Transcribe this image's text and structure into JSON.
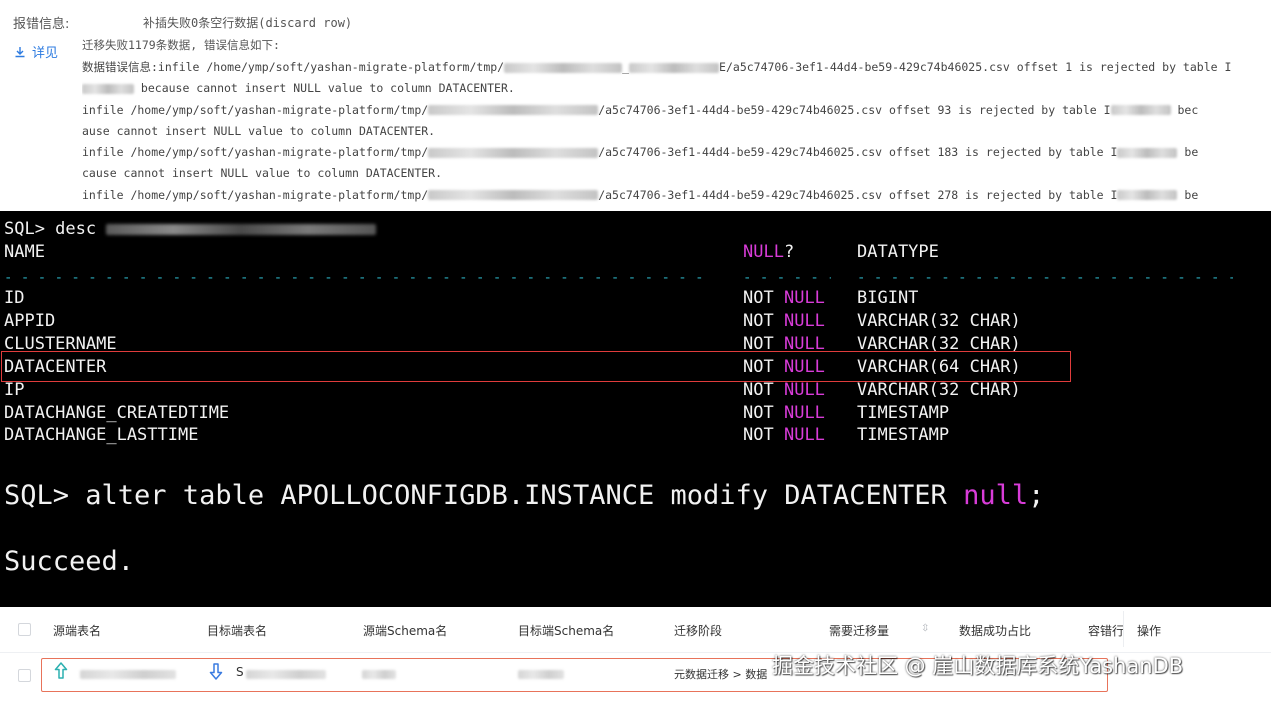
{
  "error_panel": {
    "label": "报错信息:",
    "discard_note": "补插失败0条空行数据(discard row)",
    "detail_link": "详见",
    "summary": "迁移失败1179条数据, 错误信息如下:",
    "lines": [
      {
        "pre": "数据错误信息:infile /home/ymp/soft/yashan-migrate-platform/tmp/",
        "post": "E/a5c74706-3ef1-44d4-be59-429c74b46025.csv offset 1 is rejected by table I"
      },
      {
        "pre": "",
        "post": " because cannot insert NULL value to column DATACENTER."
      },
      {
        "pre": "infile /home/ymp/soft/yashan-migrate-platform/tmp/",
        "post": "/a5c74706-3ef1-44d4-be59-429c74b46025.csv offset 93 is rejected by table I",
        "tail": " bec"
      },
      {
        "pre": "ause cannot insert NULL value to column DATACENTER.",
        "post": ""
      },
      {
        "pre": "infile /home/ymp/soft/yashan-migrate-platform/tmp/",
        "post": "/a5c74706-3ef1-44d4-be59-429c74b46025.csv offset 183 is rejected by table I",
        "tail": " be"
      },
      {
        "pre": "cause cannot insert NULL value to column DATACENTER.",
        "post": ""
      },
      {
        "pre": "infile /home/ymp/soft/yashan-migrate-platform/tmp/",
        "post": "/a5c74706-3ef1-44d4-be59-429c74b46025.csv offset 278 is rejected by table I",
        "tail": " be"
      }
    ]
  },
  "terminal": {
    "desc_cmd": "SQL> desc",
    "header": {
      "name": "NAME",
      "null_q": "NULL",
      "q": "?",
      "datatype": "DATATYPE"
    },
    "columns": [
      {
        "name": "ID",
        "not": "NOT",
        "null": "NULL",
        "type": "BIGINT"
      },
      {
        "name": "APPID",
        "not": "NOT",
        "null": "NULL",
        "type": "VARCHAR(32 CHAR)"
      },
      {
        "name": "CLUSTERNAME",
        "not": "NOT",
        "null": "NULL",
        "type": "VARCHAR(32 CHAR)"
      },
      {
        "name": "DATACENTER",
        "not": "NOT",
        "null": "NULL",
        "type": "VARCHAR(64 CHAR)"
      },
      {
        "name": "IP",
        "not": "NOT",
        "null": "NULL",
        "type": "VARCHAR(32 CHAR)"
      },
      {
        "name": "DATACHANGE_CREATEDTIME",
        "not": "NOT",
        "null": "NULL",
        "type": "TIMESTAMP"
      },
      {
        "name": "DATACHANGE_LASTTIME",
        "not": "NOT",
        "null": "NULL",
        "type": "TIMESTAMP"
      }
    ],
    "alter_cmd": "SQL> alter table APOLLOCONFIGDB.INSTANCE modify DATACENTER",
    "alter_null": "null",
    "alter_end": ";",
    "result": "Succeed.",
    "colors": {
      "keyword": "#d83cd8",
      "dashes": "#2aa8b8",
      "highlight": "#e03c3c"
    }
  },
  "table": {
    "headers": {
      "source_table": "源端表名",
      "target_table": "目标端表名",
      "source_schema": "源端Schema名",
      "target_schema": "目标端Schema名",
      "stage": "迁移阶段",
      "need_volume": "需要迁移量",
      "success_ratio": "数据成功占比",
      "fault_tolerance": "容错行",
      "actions": "操作"
    },
    "row": {
      "target_table_prefix": "S",
      "stage": "元数据迁移 > 数据"
    }
  },
  "watermark": "掘金技术社区 @ 崖山数据库系统YashanDB"
}
